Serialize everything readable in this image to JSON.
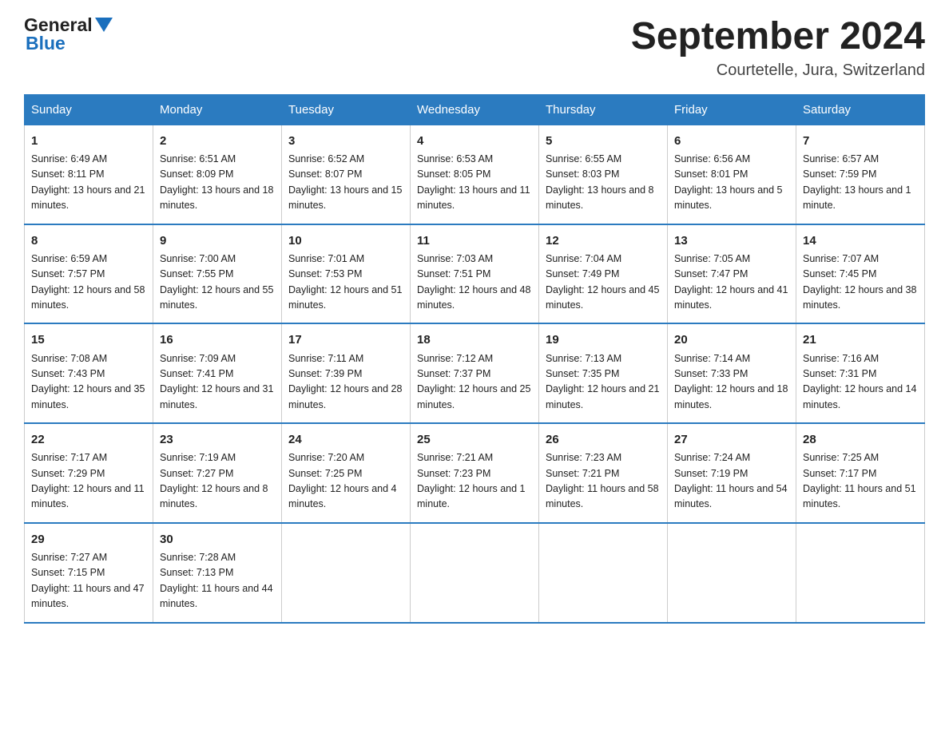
{
  "header": {
    "logo_general": "General",
    "logo_blue": "Blue",
    "month_title": "September 2024",
    "location": "Courtetelle, Jura, Switzerland"
  },
  "days_of_week": [
    "Sunday",
    "Monday",
    "Tuesday",
    "Wednesday",
    "Thursday",
    "Friday",
    "Saturday"
  ],
  "weeks": [
    [
      {
        "day": "1",
        "sunrise": "6:49 AM",
        "sunset": "8:11 PM",
        "daylight": "13 hours and 21 minutes."
      },
      {
        "day": "2",
        "sunrise": "6:51 AM",
        "sunset": "8:09 PM",
        "daylight": "13 hours and 18 minutes."
      },
      {
        "day": "3",
        "sunrise": "6:52 AM",
        "sunset": "8:07 PM",
        "daylight": "13 hours and 15 minutes."
      },
      {
        "day": "4",
        "sunrise": "6:53 AM",
        "sunset": "8:05 PM",
        "daylight": "13 hours and 11 minutes."
      },
      {
        "day": "5",
        "sunrise": "6:55 AM",
        "sunset": "8:03 PM",
        "daylight": "13 hours and 8 minutes."
      },
      {
        "day": "6",
        "sunrise": "6:56 AM",
        "sunset": "8:01 PM",
        "daylight": "13 hours and 5 minutes."
      },
      {
        "day": "7",
        "sunrise": "6:57 AM",
        "sunset": "7:59 PM",
        "daylight": "13 hours and 1 minute."
      }
    ],
    [
      {
        "day": "8",
        "sunrise": "6:59 AM",
        "sunset": "7:57 PM",
        "daylight": "12 hours and 58 minutes."
      },
      {
        "day": "9",
        "sunrise": "7:00 AM",
        "sunset": "7:55 PM",
        "daylight": "12 hours and 55 minutes."
      },
      {
        "day": "10",
        "sunrise": "7:01 AM",
        "sunset": "7:53 PM",
        "daylight": "12 hours and 51 minutes."
      },
      {
        "day": "11",
        "sunrise": "7:03 AM",
        "sunset": "7:51 PM",
        "daylight": "12 hours and 48 minutes."
      },
      {
        "day": "12",
        "sunrise": "7:04 AM",
        "sunset": "7:49 PM",
        "daylight": "12 hours and 45 minutes."
      },
      {
        "day": "13",
        "sunrise": "7:05 AM",
        "sunset": "7:47 PM",
        "daylight": "12 hours and 41 minutes."
      },
      {
        "day": "14",
        "sunrise": "7:07 AM",
        "sunset": "7:45 PM",
        "daylight": "12 hours and 38 minutes."
      }
    ],
    [
      {
        "day": "15",
        "sunrise": "7:08 AM",
        "sunset": "7:43 PM",
        "daylight": "12 hours and 35 minutes."
      },
      {
        "day": "16",
        "sunrise": "7:09 AM",
        "sunset": "7:41 PM",
        "daylight": "12 hours and 31 minutes."
      },
      {
        "day": "17",
        "sunrise": "7:11 AM",
        "sunset": "7:39 PM",
        "daylight": "12 hours and 28 minutes."
      },
      {
        "day": "18",
        "sunrise": "7:12 AM",
        "sunset": "7:37 PM",
        "daylight": "12 hours and 25 minutes."
      },
      {
        "day": "19",
        "sunrise": "7:13 AM",
        "sunset": "7:35 PM",
        "daylight": "12 hours and 21 minutes."
      },
      {
        "day": "20",
        "sunrise": "7:14 AM",
        "sunset": "7:33 PM",
        "daylight": "12 hours and 18 minutes."
      },
      {
        "day": "21",
        "sunrise": "7:16 AM",
        "sunset": "7:31 PM",
        "daylight": "12 hours and 14 minutes."
      }
    ],
    [
      {
        "day": "22",
        "sunrise": "7:17 AM",
        "sunset": "7:29 PM",
        "daylight": "12 hours and 11 minutes."
      },
      {
        "day": "23",
        "sunrise": "7:19 AM",
        "sunset": "7:27 PM",
        "daylight": "12 hours and 8 minutes."
      },
      {
        "day": "24",
        "sunrise": "7:20 AM",
        "sunset": "7:25 PM",
        "daylight": "12 hours and 4 minutes."
      },
      {
        "day": "25",
        "sunrise": "7:21 AM",
        "sunset": "7:23 PM",
        "daylight": "12 hours and 1 minute."
      },
      {
        "day": "26",
        "sunrise": "7:23 AM",
        "sunset": "7:21 PM",
        "daylight": "11 hours and 58 minutes."
      },
      {
        "day": "27",
        "sunrise": "7:24 AM",
        "sunset": "7:19 PM",
        "daylight": "11 hours and 54 minutes."
      },
      {
        "day": "28",
        "sunrise": "7:25 AM",
        "sunset": "7:17 PM",
        "daylight": "11 hours and 51 minutes."
      }
    ],
    [
      {
        "day": "29",
        "sunrise": "7:27 AM",
        "sunset": "7:15 PM",
        "daylight": "11 hours and 47 minutes."
      },
      {
        "day": "30",
        "sunrise": "7:28 AM",
        "sunset": "7:13 PM",
        "daylight": "11 hours and 44 minutes."
      },
      null,
      null,
      null,
      null,
      null
    ]
  ]
}
